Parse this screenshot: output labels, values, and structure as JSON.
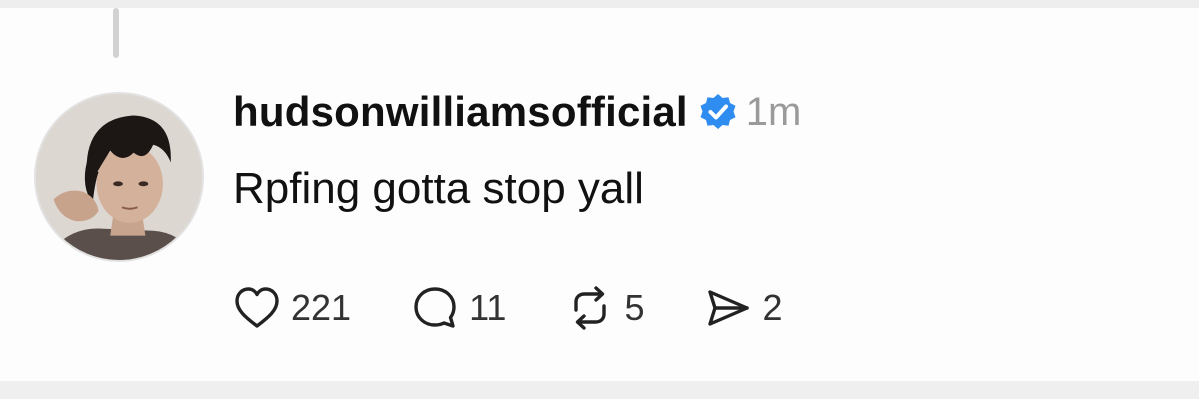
{
  "post": {
    "username": "hudsonwilliamsofficial",
    "verified": true,
    "timestamp": "1m",
    "text": "Rpfing gotta stop yall",
    "avatar": "profile-photo"
  },
  "actions": {
    "like": {
      "icon": "heart-icon",
      "count": "221"
    },
    "reply": {
      "icon": "comment-icon",
      "count": "11"
    },
    "repost": {
      "icon": "repost-icon",
      "count": "5"
    },
    "share": {
      "icon": "send-icon",
      "count": "2"
    }
  },
  "colors": {
    "verified_badge": "#2f8cf0",
    "text": "#111111",
    "muted": "#9a9a9a"
  }
}
